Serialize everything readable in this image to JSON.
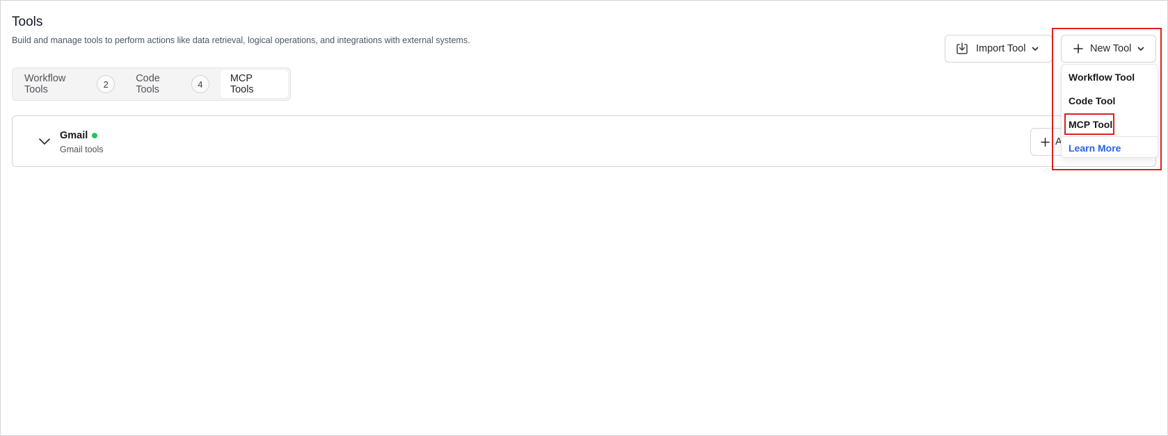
{
  "header": {
    "title": "Tools",
    "subtitle": "Build and manage tools to perform actions like data retrieval, logical operations, and integrations with external systems."
  },
  "tabs": [
    {
      "label": "Workflow Tools",
      "count": "2",
      "active": false
    },
    {
      "label": "Code Tools",
      "count": "4",
      "active": false
    },
    {
      "label": "MCP Tools",
      "count": "",
      "active": true
    }
  ],
  "toolbar": {
    "import_label": "Import Tool",
    "new_label": "New Tool",
    "import_icon": "download-tray-icon",
    "new_icon": "plus-icon"
  },
  "servers": [
    {
      "name": "Gmail",
      "description": "Gmail tools",
      "status_color": "#22c55e",
      "action_label": "A"
    }
  ],
  "dropdown": {
    "items": [
      "Workflow Tool",
      "Code Tool",
      "MCP Tool"
    ],
    "learn_more": "Learn More",
    "highlighted": "MCP Tool"
  },
  "colors": {
    "accent_link": "#2563eb",
    "highlight": "#e11d1d",
    "status_online": "#22c55e"
  }
}
